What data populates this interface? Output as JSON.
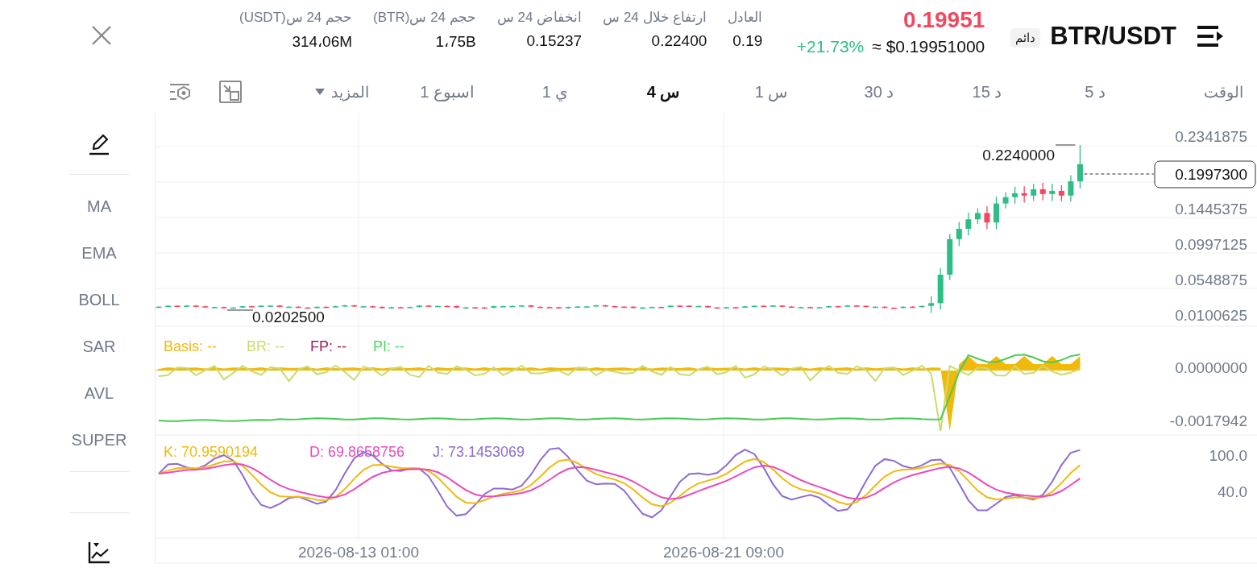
{
  "header": {
    "pair": "BTR/USDT",
    "badge": "دائم",
    "last_price": "0.19951",
    "usd_price": "≈ $0.19951000",
    "change": "+21.73%",
    "stats": [
      {
        "label": "العادل",
        "value": "0.19"
      },
      {
        "label": "ارتفاع خلال 24 س",
        "value": "0.22400"
      },
      {
        "label": "انخفاض 24 س",
        "value": "0.15237"
      },
      {
        "label": "حجم 24 س(BTR)",
        "value": "1،75B"
      },
      {
        "label": "حجم 24 س(USDT)",
        "value": "314،06M"
      }
    ]
  },
  "timeframes": {
    "label": "الوقت",
    "more": "المزيد",
    "items": [
      {
        "label": "5 د",
        "selected": false
      },
      {
        "label": "15 د",
        "selected": false
      },
      {
        "label": "30 د",
        "selected": false
      },
      {
        "label": "1 س",
        "selected": false
      },
      {
        "label": "4 س",
        "selected": true
      },
      {
        "label": "1 ي",
        "selected": false
      },
      {
        "label": "1 اسبوع",
        "selected": false
      }
    ]
  },
  "sidebar": {
    "items": [
      "MA",
      "EMA",
      "BOLL",
      "SAR",
      "AVL",
      "SUPER"
    ]
  },
  "chart": {
    "price_axis": [
      "0.2341875",
      "0.1445375",
      "0.0997125",
      "0.0548875",
      "0.0100625"
    ],
    "high_label": "0.2240000",
    "low_label": "0.0202500",
    "current_price": "0.1997300",
    "basis_legend": [
      {
        "text": "PI: --",
        "color": "#4cd964"
      },
      {
        "text": "FP: --",
        "color": "#a0195a"
      },
      {
        "text": "BR: --",
        "color": "#c8dc6e"
      },
      {
        "text": "Basis: --",
        "color": "#f0b90b"
      }
    ],
    "basis_axis": [
      "0.0000000",
      "-0.0017942"
    ],
    "kdj_legend": [
      {
        "text": "J: 73.1453069",
        "color": "#8e6bd0"
      },
      {
        "text": "D: 69.8658756",
        "color": "#e84bbd"
      },
      {
        "text": "K: 70.9590194",
        "color": "#f0b90b"
      }
    ],
    "kdj_axis": [
      "100.0",
      "40.0"
    ],
    "time_axis": [
      "2026-08-21 09:00",
      "2026-08-13 01:00"
    ]
  }
}
